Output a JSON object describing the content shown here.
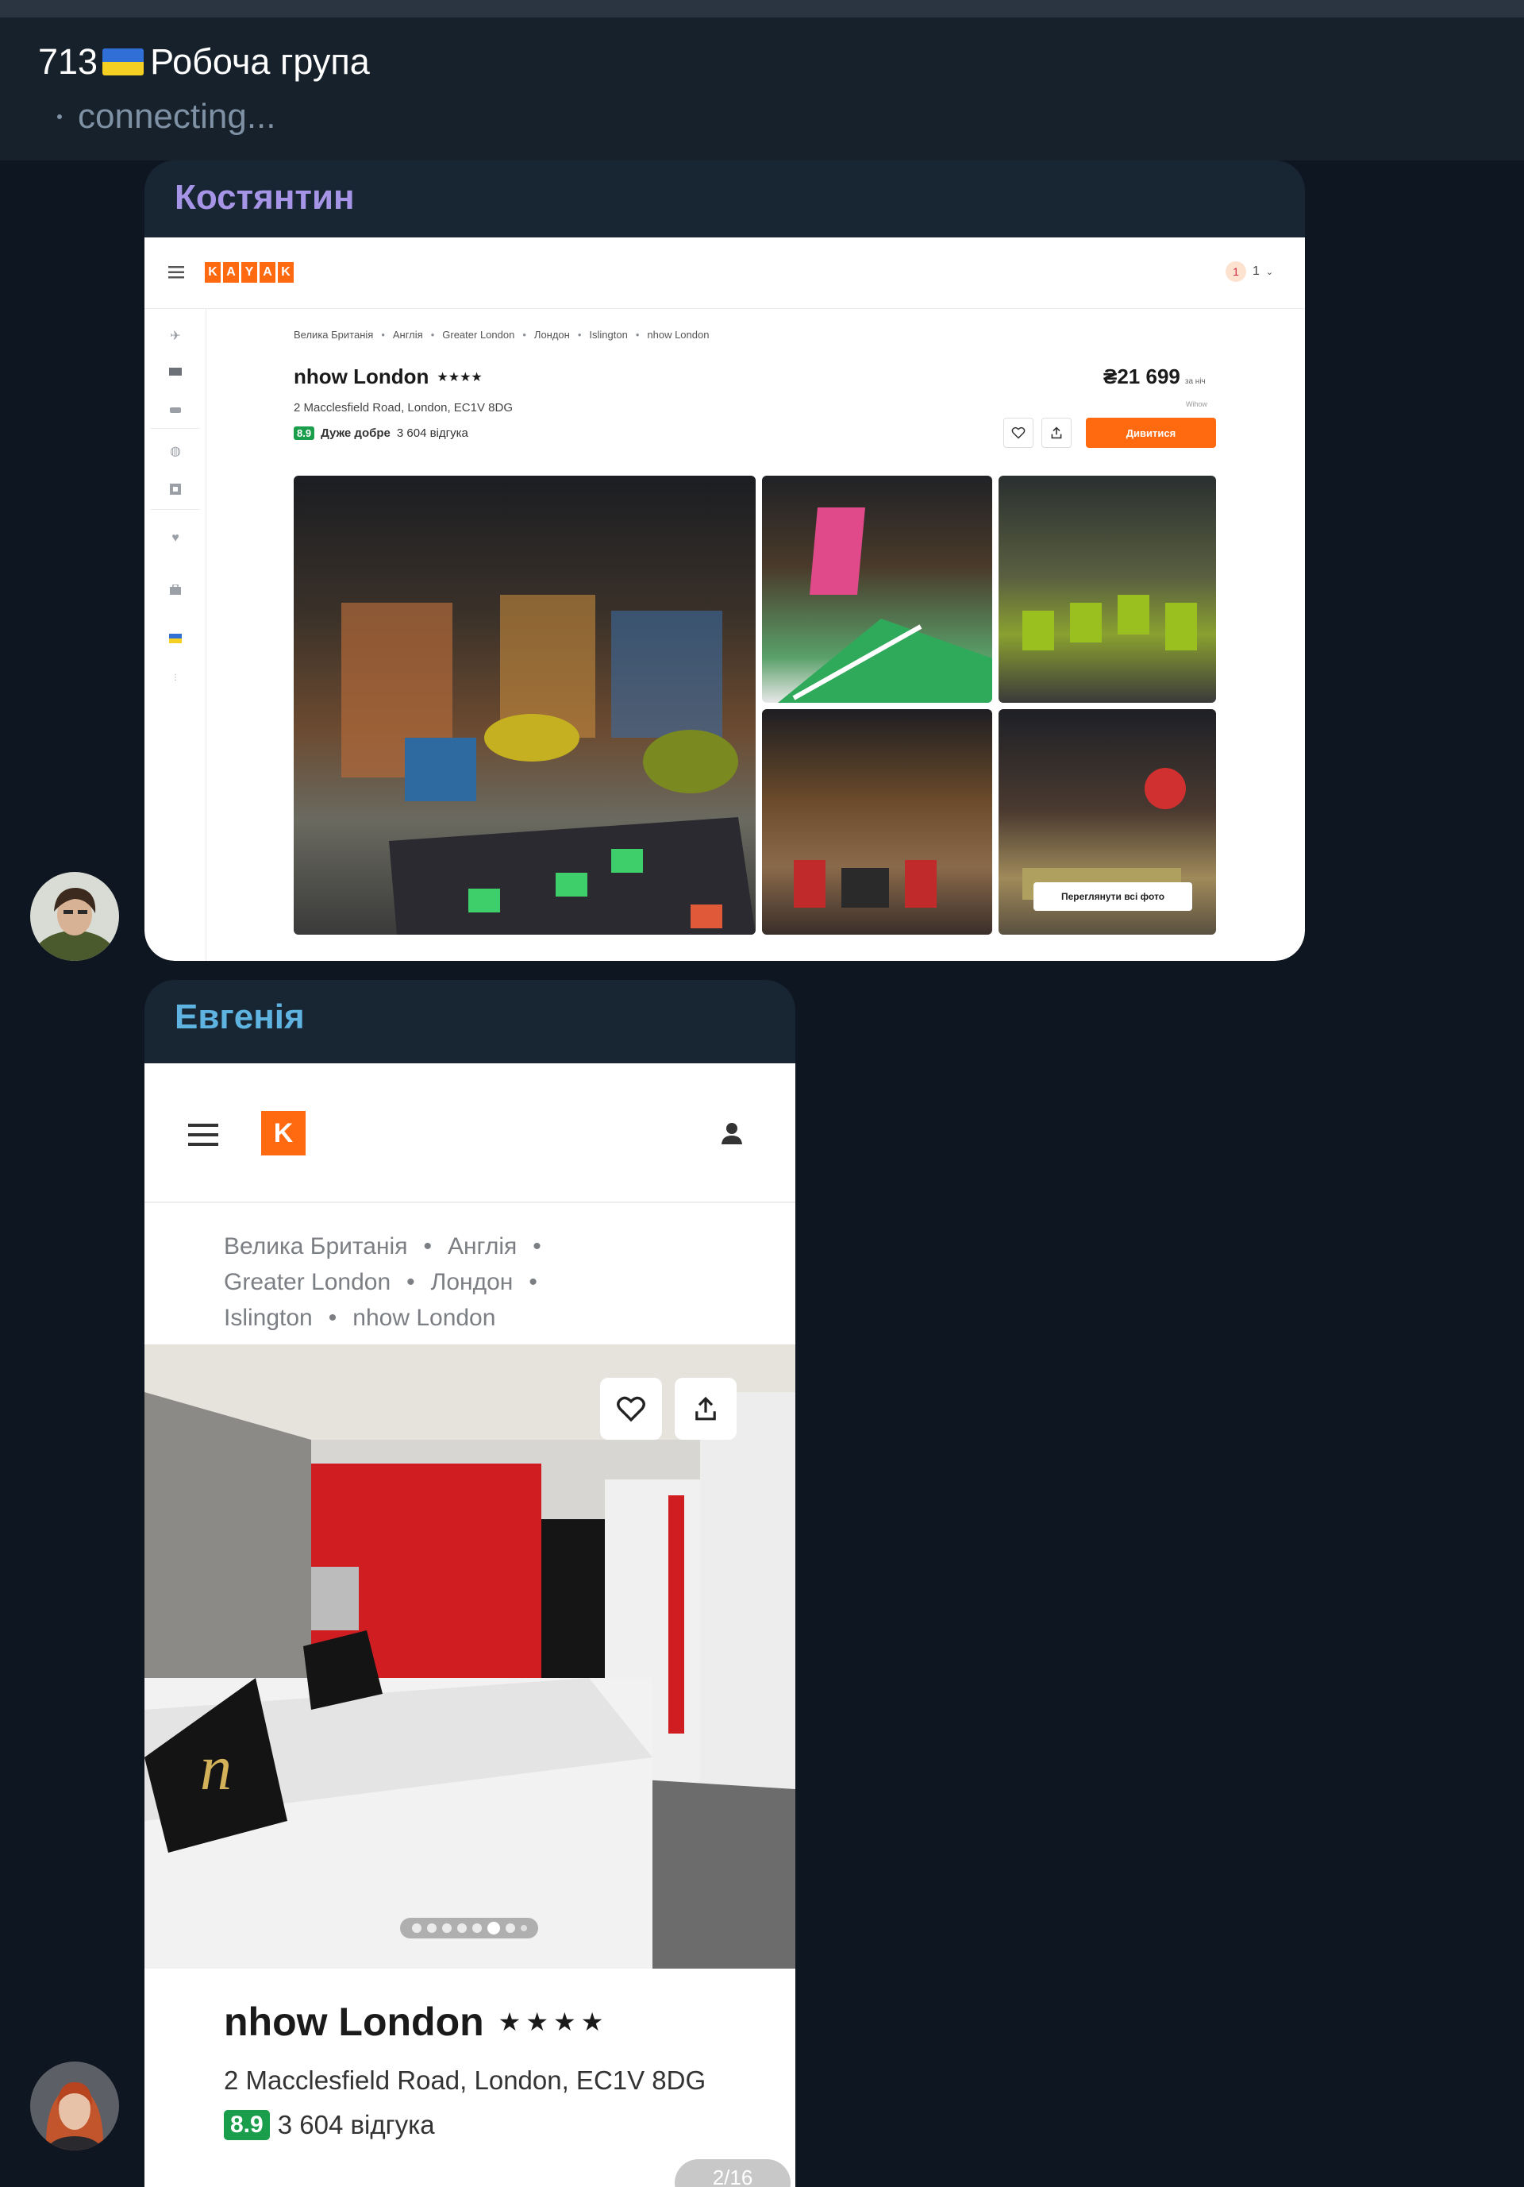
{
  "chat": {
    "title_number": "713",
    "title_name": "Робоча група",
    "status": "connecting..."
  },
  "messages": [
    {
      "sender": "Костянтин",
      "sender_color": "#a695e7",
      "screenshot": {
        "logo": "KAYAK",
        "logo_letters": [
          "K",
          "A",
          "Y",
          "A",
          "K"
        ],
        "currency_badge": "1",
        "rooms": "1",
        "breadcrumbs": [
          "Велика Британія",
          "Англія",
          "Greater London",
          "Лондон",
          "Islington",
          "nhow London"
        ],
        "hotel_name": "nhow London",
        "stars": "★★★★",
        "address": "2 Macclesfield Road, London, EC1V 8DG",
        "rating": "8.9",
        "rating_label": "Дуже добре",
        "reviews": "3 604 відгука",
        "price": "₴21 699",
        "price_unit": "за ніч",
        "price_note": "Wihow",
        "cta": "Дивитися",
        "view_all": "Переглянути всі фото"
      }
    },
    {
      "sender": "Евгенія",
      "sender_color": "#5fb3e0",
      "screenshot": {
        "logo_letter": "K",
        "breadcrumb_lines": [
          [
            "Велика Британія",
            "Англія"
          ],
          [
            "Greater London",
            "Лондон"
          ],
          [
            "Islington",
            "nhow London"
          ]
        ],
        "hotel_name": "nhow London",
        "stars": "★★★★",
        "address": "2 Macclesfield Road, London, EC1V 8DG",
        "rating": "8.9",
        "reviews": "3 604 відгука",
        "photo_counter": "2/16",
        "carousel_dot_count": 8,
        "carousel_active": 6
      }
    }
  ],
  "colors": {
    "app_bg": "#0e1621",
    "header_bg": "#17212b",
    "bubble_bg": "#182533",
    "kayak_orange": "#ff690f",
    "rating_green": "#1a9e4b"
  },
  "icons": {
    "flag": "ukraine-flag-icon",
    "menu": "hamburger-menu-icon",
    "heart": "heart-icon",
    "share": "share-icon",
    "user": "user-icon"
  }
}
